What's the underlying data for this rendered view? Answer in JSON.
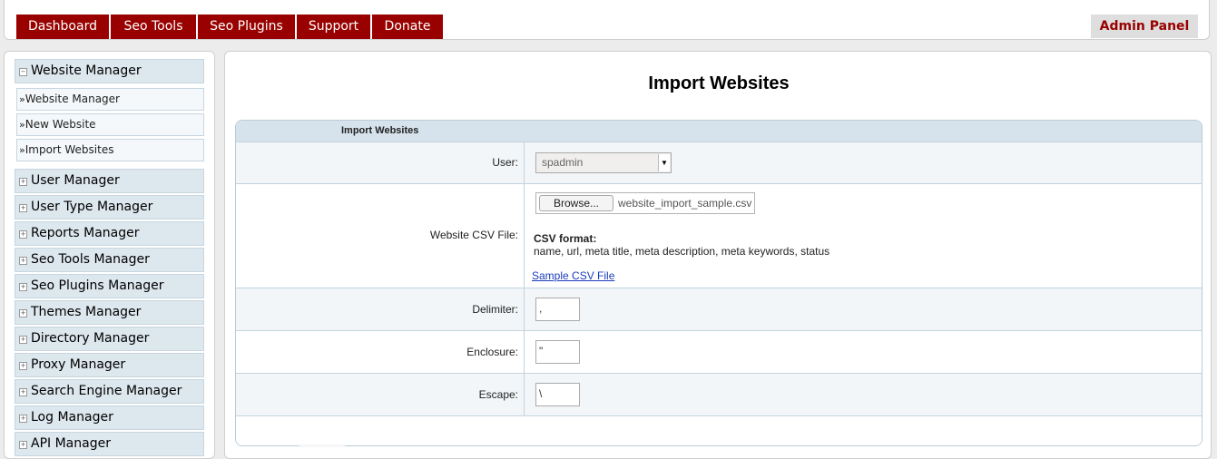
{
  "nav": {
    "items": [
      "Dashboard",
      "Seo Tools",
      "Seo Plugins",
      "Support",
      "Donate"
    ],
    "admin_panel": "Admin Panel"
  },
  "sidebar": {
    "website_manager": "Website Manager",
    "sub_items": [
      "Website Manager",
      "New Website",
      "Import Websites"
    ],
    "sections": [
      "User Manager",
      "User Type Manager",
      "Reports Manager",
      "Seo Tools Manager",
      "Seo Plugins Manager",
      "Themes Manager",
      "Directory Manager",
      "Proxy Manager",
      "Search Engine Manager",
      "Log Manager",
      "API Manager"
    ]
  },
  "main": {
    "title": "Import Websites",
    "form_header": "Import Websites",
    "user_label": "User:",
    "user_value": "spadmin",
    "csv_label": "Website CSV File:",
    "browse_label": "Browse...",
    "file_name": "website_import_sample.csv",
    "csv_format_title": "CSV format:",
    "csv_format_fields": "name, url, meta title, meta description, meta keywords, status",
    "sample_link": "Sample CSV File",
    "delimiter_label": "Delimiter:",
    "delimiter_value": ",",
    "enclosure_label": "Enclosure:",
    "enclosure_value": "\"",
    "escape_label": "Escape:",
    "escape_value": "\\"
  },
  "colors": {
    "nav_bg": "#990000",
    "admin_text": "#990000",
    "link": "#1a3cbb"
  }
}
